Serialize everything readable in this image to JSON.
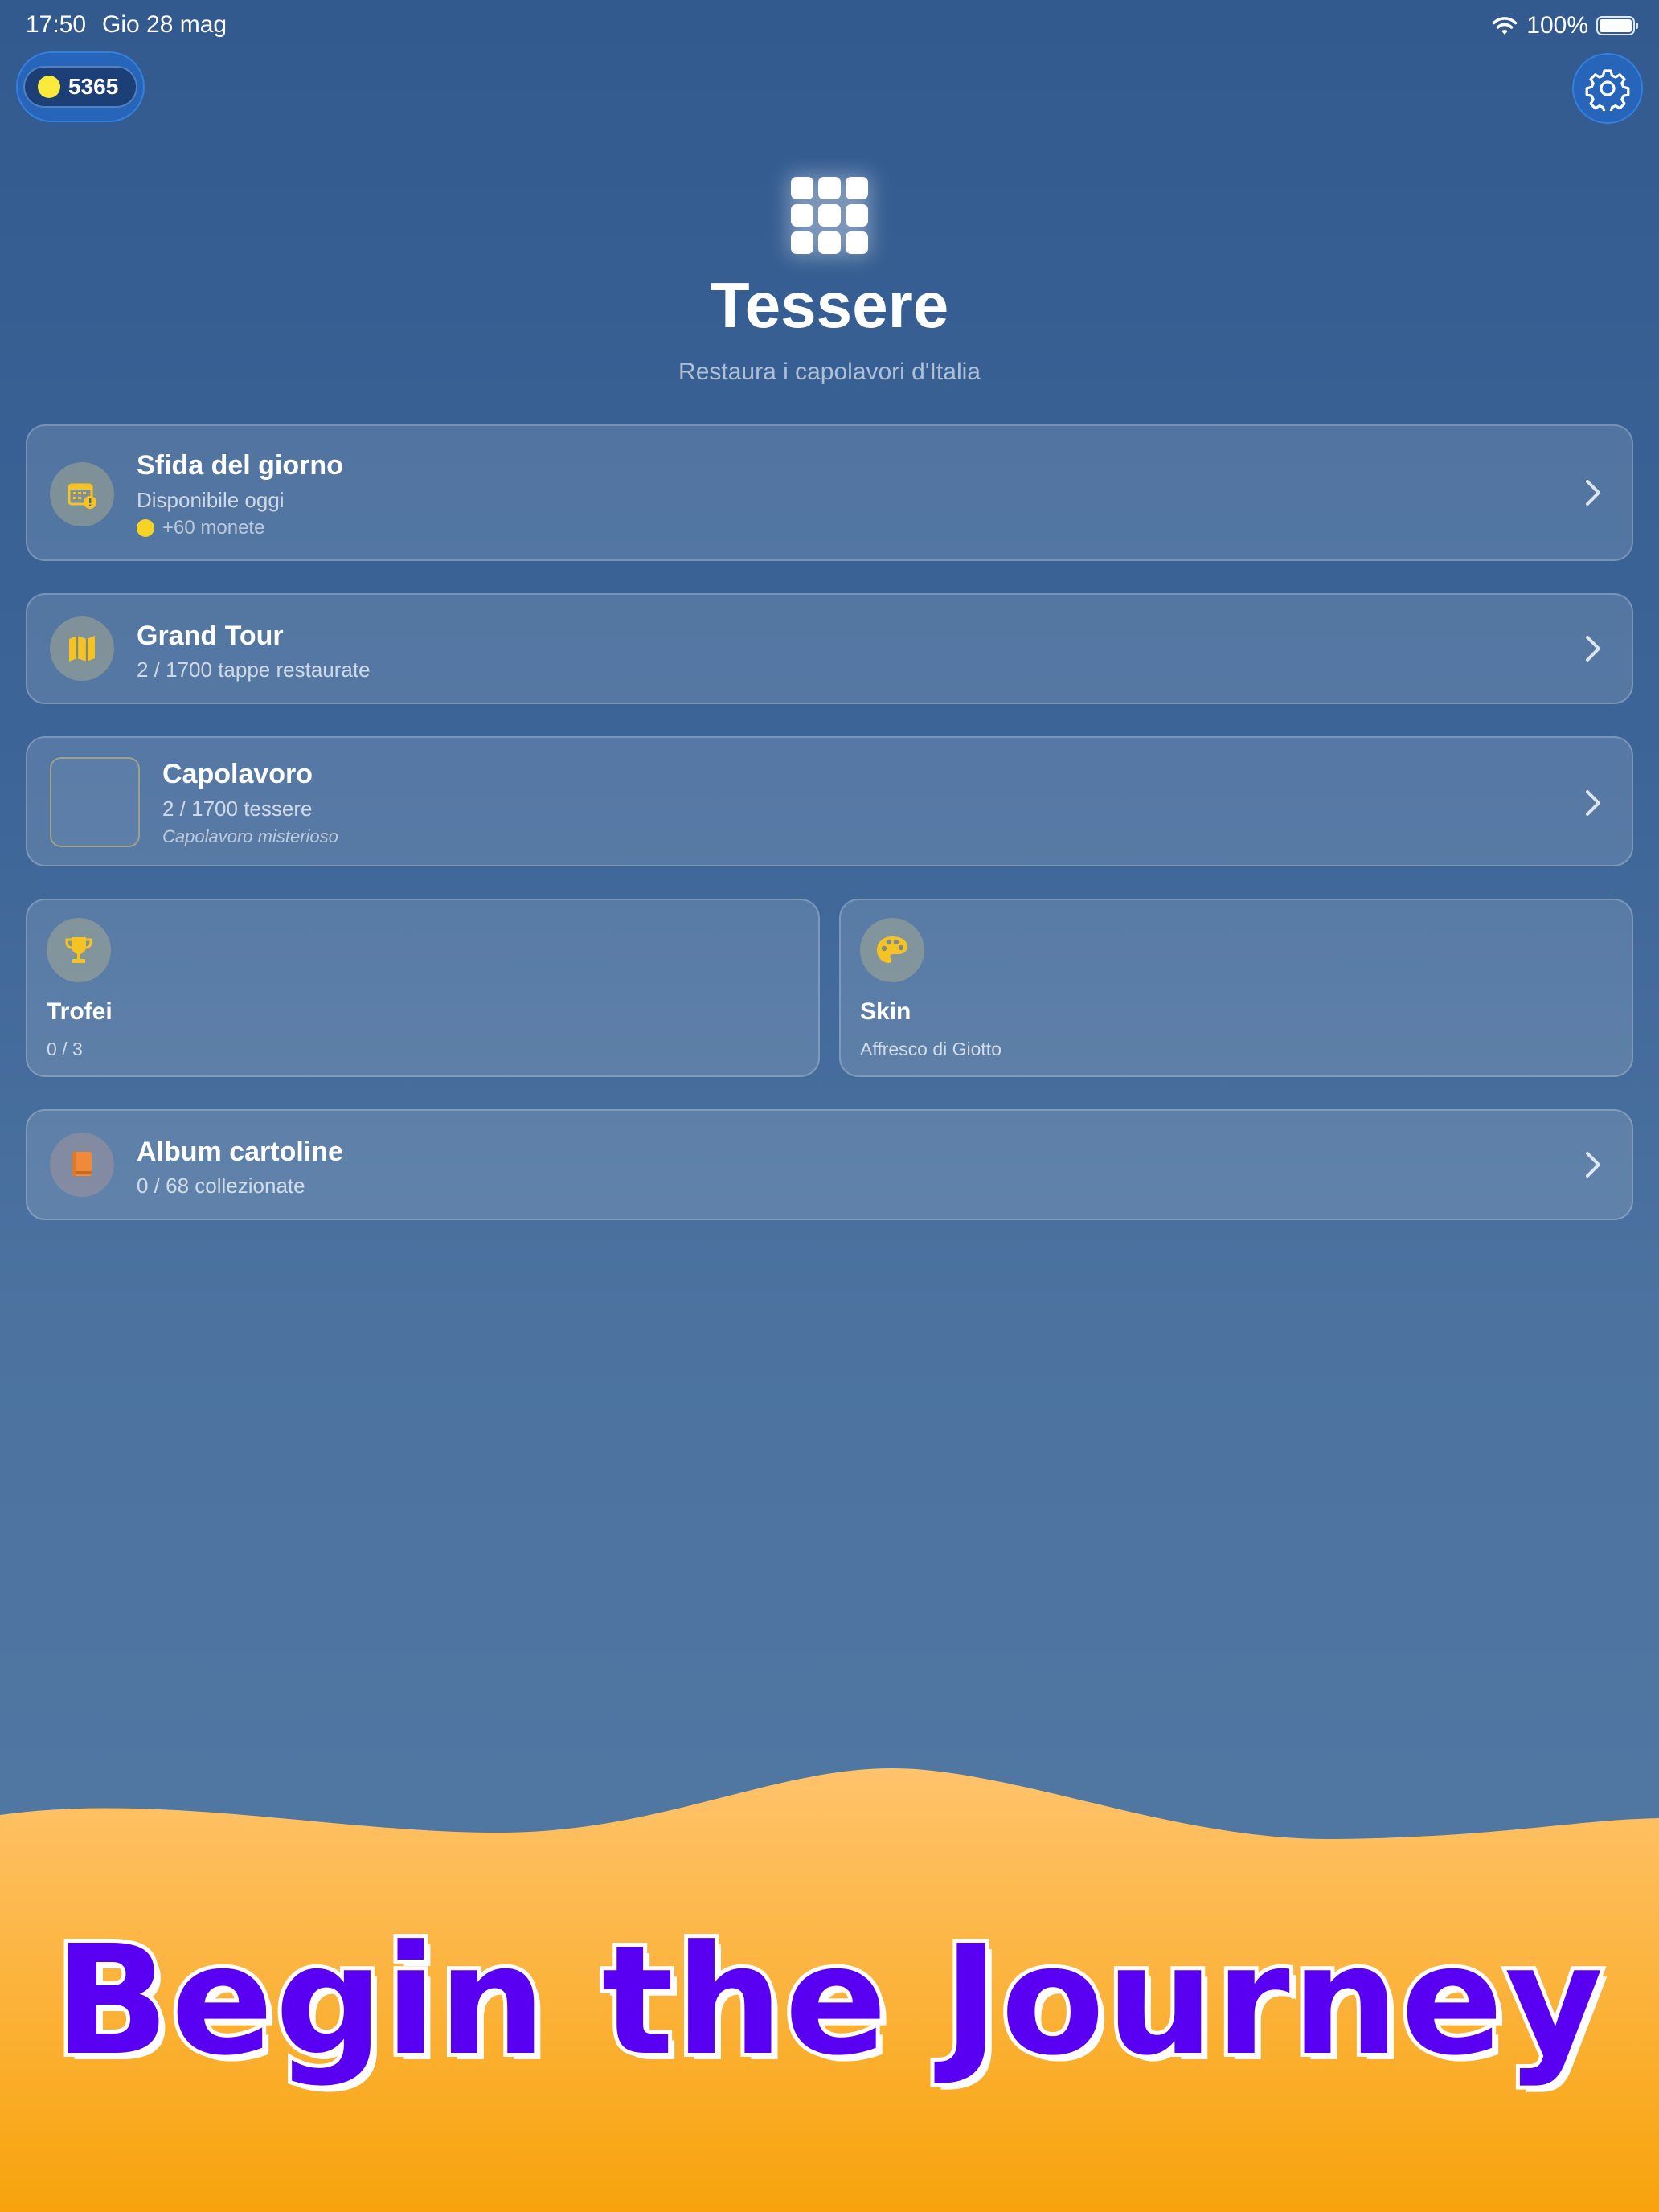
{
  "status_bar": {
    "time": "17:50",
    "date": "Gio 28 mag",
    "battery_pct": "100%"
  },
  "coins": {
    "value": "5365",
    "coin_color": "#fbe93b"
  },
  "settings": {
    "icon": "gear-icon"
  },
  "header": {
    "logo_icon": "grid-tiles-icon",
    "title": "Tessere",
    "subtitle": "Restaura i capolavori d'Italia"
  },
  "cards": {
    "daily": {
      "icon": "calendar-alert-icon",
      "title": "Sfida del giorno",
      "subtitle": "Disponibile oggi",
      "reward": "+60 monete"
    },
    "grand_tour": {
      "icon": "map-icon",
      "title": "Grand Tour",
      "subtitle": "2 / 1700 tappe restaurate"
    },
    "masterpiece": {
      "title": "Capolavoro",
      "subtitle": "2 / 1700 tessere",
      "note": "Capolavoro misterioso"
    },
    "trophies": {
      "icon": "trophy-icon",
      "title": "Trofei",
      "subtitle": "0 / 3"
    },
    "skin": {
      "icon": "palette-icon",
      "title": "Skin",
      "subtitle": "Affresco di Giotto"
    },
    "album": {
      "icon": "book-icon",
      "title": "Album cartoline",
      "subtitle": "0 / 68 collezionate"
    }
  },
  "banner": {
    "text": "Begin the Journey"
  },
  "colors": {
    "accent_gold": "#f6c324",
    "icon_orange": "#f08a3a",
    "banner_purple": "#5a00f2",
    "sand_top": "#ffc36b",
    "sand_bottom": "#f8a30c"
  }
}
